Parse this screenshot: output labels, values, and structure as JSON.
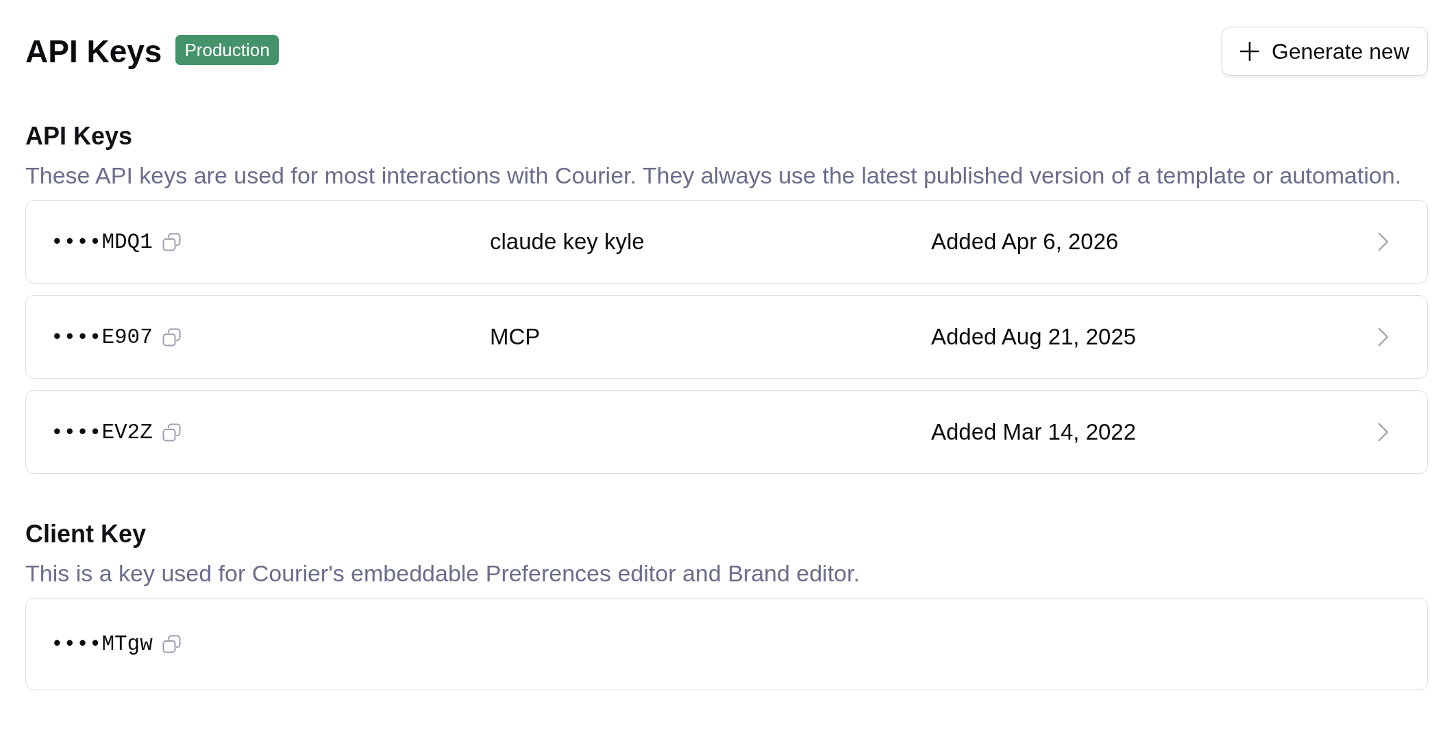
{
  "header": {
    "title": "API Keys",
    "environment_badge": "Production",
    "generate_button": {
      "label": "Generate new"
    }
  },
  "sections": [
    {
      "kind": "list",
      "title": "API Keys",
      "description": "These API keys are used for most interactions with Courier. They always use the latest published version of a template or automation.",
      "keys": [
        {
          "masked_key": "••••MDQ1",
          "name": "claude key kyle",
          "added": "Added Apr 6, 2026"
        },
        {
          "masked_key": "••••E907",
          "name": "MCP",
          "added": "Added Aug 21, 2025"
        },
        {
          "masked_key": "••••EV2Z",
          "added": "Added Mar 14, 2022"
        }
      ]
    },
    {
      "kind": "single",
      "title": "Client Key",
      "description": "This is a key used for Courier's embeddable Preferences editor and Brand editor.",
      "keys": [
        {
          "masked_key": "••••MTgw"
        }
      ]
    }
  ]
}
